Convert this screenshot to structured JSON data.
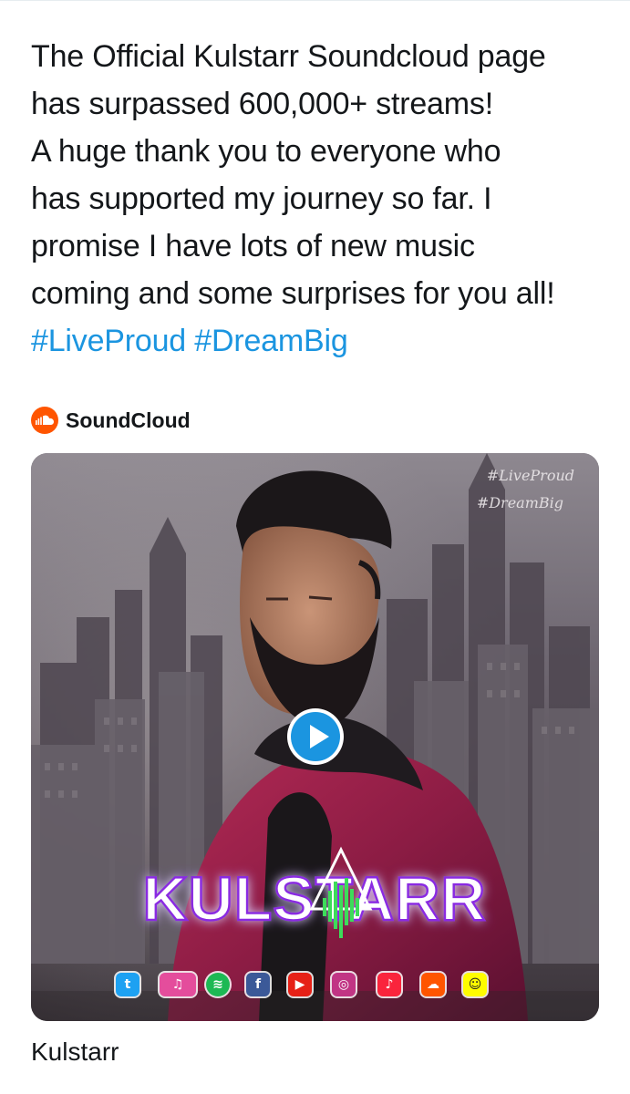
{
  "tweet": {
    "lines": [
      "The Official Kulstarr Soundcloud page",
      "has surpassed 600,000+ streams!",
      "A huge thank you to everyone who",
      "has supported my journey so far. I",
      "promise I have lots of new music",
      "coming and some surprises for you all!"
    ],
    "hashtags": [
      "#LiveProud",
      "#DreamBig"
    ]
  },
  "card": {
    "source_name": "SoundCloud",
    "source_icon": "soundcloud-icon",
    "artwork": {
      "brand_logo_text": "KULSTARR",
      "overlay_hashtags": [
        "#LiveProud",
        "#DreamBig"
      ],
      "social_icons": [
        "twitter-icon",
        "itunes-icon",
        "spotify-icon",
        "facebook-icon",
        "youtube-icon",
        "instagram-icon",
        "apple-music-icon",
        "soundcloud-icon",
        "snapchat-icon"
      ]
    },
    "play_icon": "play-icon",
    "title": "Kulstarr"
  },
  "colors": {
    "text": "#14171a",
    "link": "#1b95e0",
    "soundcloud": "#ff5500",
    "play_button": "#1b95e0",
    "logo_glow": "#8a2be2",
    "logo_equalizer": "#3ddc5a"
  }
}
